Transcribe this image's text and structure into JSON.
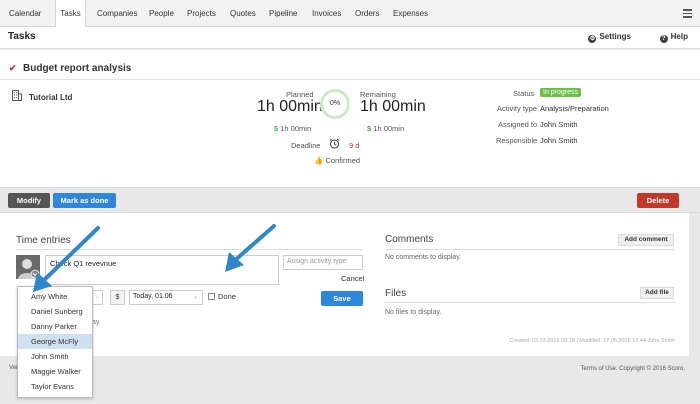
{
  "nav": {
    "tabs": [
      "Calendar",
      "Tasks",
      "Companies",
      "People",
      "Projects",
      "Quotes",
      "Pipeline",
      "Invoices",
      "Orders",
      "Expenses"
    ],
    "active": "Tasks",
    "menu_icon": "hamburger-icon"
  },
  "header": {
    "title": "Tasks",
    "settings_label": "Settings",
    "help_label": "Help",
    "settings_icon": "gear-icon",
    "help_icon": "question-icon"
  },
  "task": {
    "title": "Budget report analysis",
    "company": "Tutorial Ltd",
    "planned_label": "Planned",
    "planned_value": "1h 00min",
    "planned_cost": "1h 00min",
    "remaining_label": "Remaining",
    "remaining_value": "1h 00min",
    "remaining_cost": "1h 00min",
    "currency_symbol": "$",
    "progress": "0%",
    "deadline_label": "Deadline",
    "deadline_value": "9 d",
    "confirmed_label": "Confirmed",
    "details": {
      "status_label": "Status",
      "status_value": "In progress",
      "activity_label": "Activity type",
      "activity_value": "Analysis/Preparation",
      "assigned_label": "Assigned to",
      "assigned_value": "John Smith",
      "responsible_label": "Responsible",
      "responsible_value": "John Smith"
    },
    "colors": {
      "status": "#6cc04a",
      "deadline": "#c0392b"
    }
  },
  "actions": {
    "modify": "Modify",
    "mark_done": "Mark as done",
    "delete": "Delete",
    "colors": {
      "modify": "#555555",
      "mark_done": "#2e87d8",
      "delete": "#c0392b"
    }
  },
  "time_entries": {
    "title": "Time entries",
    "description": "Check Q1 revevnue",
    "activity_placeholder": "Assign activity type",
    "cancel": "Cancel",
    "currency": "$",
    "date": "Today, 01.06",
    "done_label": "Done",
    "save": "Save",
    "partial_text": "ay."
  },
  "user_dropdown": {
    "items": [
      "Amy White",
      "Daniel Sunberg",
      "Danny Parker",
      "George McFly",
      "John Smith",
      "Maggie Walker",
      "Taylor Evans"
    ],
    "selected": "George McFly"
  },
  "comments": {
    "title": "Comments",
    "add_label": "Add comment",
    "empty": "No comments to display."
  },
  "files": {
    "title": "Files",
    "add_label": "Add file",
    "empty": "No files to display."
  },
  "meta": "Created: 03.03.2016 05:18 | Modified: 17.05.2016 12:44 John Smith",
  "footer": {
    "left": "Ver",
    "right": "Terms of Use. Copyright © 2016 Scoro."
  }
}
